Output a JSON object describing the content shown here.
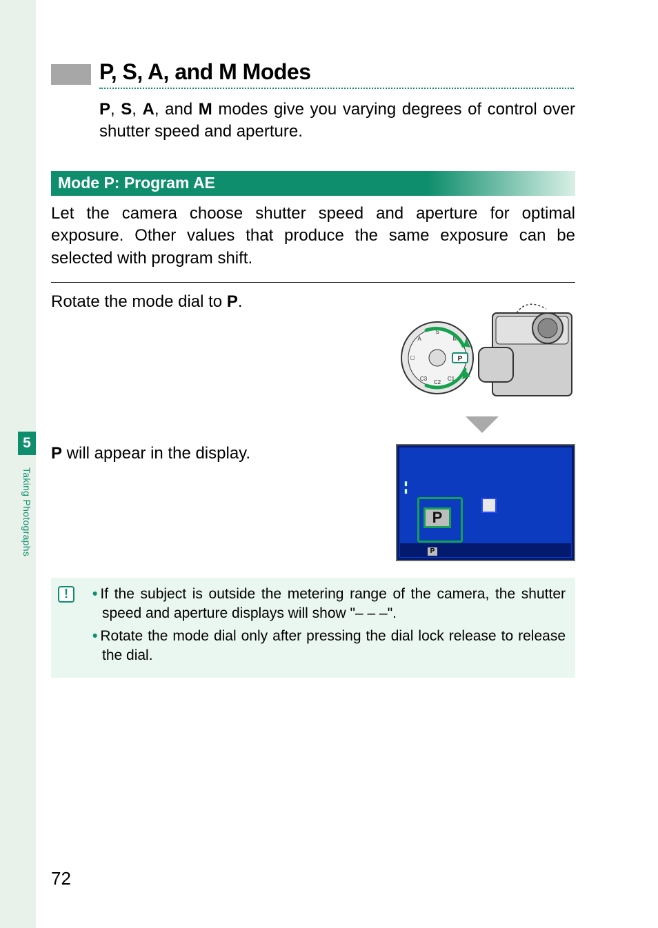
{
  "sidebar": {
    "chapter_number": "5",
    "chapter_label": "Taking Photographs"
  },
  "heading": {
    "title": "P, S, A, and M Modes"
  },
  "intro": {
    "p_prefix": "P",
    "s": "S",
    "a": "A",
    "m": "M",
    "rest1": ", ",
    "rest2": ", ",
    "rest3": ", and ",
    "rest4": " modes give you varying degrees of control over shutter speed and aperture."
  },
  "mode_p": {
    "bar_label": "Mode P: Program AE",
    "body": "Let the camera choose shutter speed and aperture for optimal exposure. Other values that produce the same exposure can be selected with program shift.",
    "step1_pre": "Rotate the mode dial to ",
    "step1_bold": "P",
    "step1_post": ".",
    "step2_bold": "P",
    "step2_post": " will appear in the display.",
    "lcd_p_label": "P",
    "lcd_p_small": "P"
  },
  "notes": {
    "icon_glyph": "!",
    "items": [
      "If the subject is outside the metering range of the camera, the shutter speed and aperture displays will show \"– – –\".",
      "Rotate the mode dial only after pressing the dial lock release to release the dial."
    ]
  },
  "page_number": "72"
}
